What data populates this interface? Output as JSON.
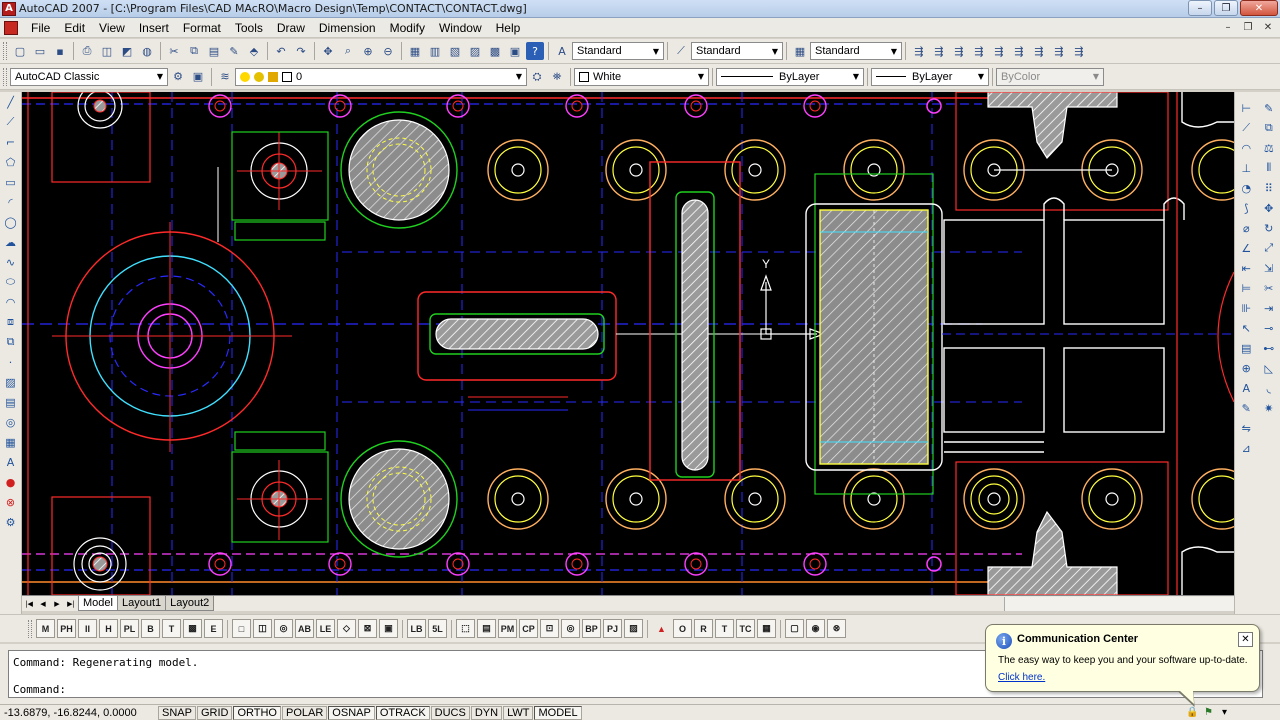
{
  "window": {
    "title": "AutoCAD 2007 - [C:\\Program Files\\CAD MAcRO\\Macro Design\\Temp\\CONTACT\\CONTACT.dwg]",
    "minimize": "–",
    "restore": "❐",
    "close": "✕"
  },
  "menu": {
    "items": [
      "File",
      "Edit",
      "View",
      "Insert",
      "Format",
      "Tools",
      "Draw",
      "Dimension",
      "Modify",
      "Window",
      "Help"
    ],
    "doc_minimize": "–",
    "doc_restore": "❐",
    "doc_close": "✕"
  },
  "toolbar1": {
    "text_style": "Standard",
    "dim_style": "Standard",
    "table_style": "Standard"
  },
  "toolbar2": {
    "workspace": "AutoCAD Classic",
    "layer": "0",
    "color": "White",
    "linetype": "ByLayer",
    "lineweight": "ByLayer",
    "plotstyle": "ByColor"
  },
  "tabs": {
    "items": [
      "Model",
      "Layout1",
      "Layout2"
    ],
    "active": "Model"
  },
  "ucs": {
    "y_label": "Y"
  },
  "command": {
    "history": "Command: Regenerating model.",
    "prompt": "Command:"
  },
  "status": {
    "coords": "-13.6879, -16.8244, 0.0000",
    "buttons": [
      {
        "label": "SNAP",
        "on": false
      },
      {
        "label": "GRID",
        "on": false
      },
      {
        "label": "ORTHO",
        "on": true
      },
      {
        "label": "POLAR",
        "on": false
      },
      {
        "label": "OSNAP",
        "on": true
      },
      {
        "label": "OTRACK",
        "on": true
      },
      {
        "label": "DUCS",
        "on": false
      },
      {
        "label": "DYN",
        "on": false
      },
      {
        "label": "LWT",
        "on": false
      },
      {
        "label": "MODEL",
        "on": true
      }
    ]
  },
  "comm_center": {
    "title": "Communication Center",
    "message": "The easy way to keep you and your software up-to-date.",
    "link": "Click here.",
    "close": "✕"
  },
  "colors": {
    "canvas_bg": "#000000",
    "red": "#ff2a2a",
    "blue": "#2a2aff",
    "magenta": "#ff40ff",
    "yellow": "#ffff40",
    "green": "#20d020",
    "cyan": "#40e0ff",
    "white": "#ffffff",
    "hatch": "#d8d8d8",
    "accent_title": "#b7cde8"
  },
  "icons": {
    "app": "autocad-icon",
    "info": "info-icon"
  }
}
